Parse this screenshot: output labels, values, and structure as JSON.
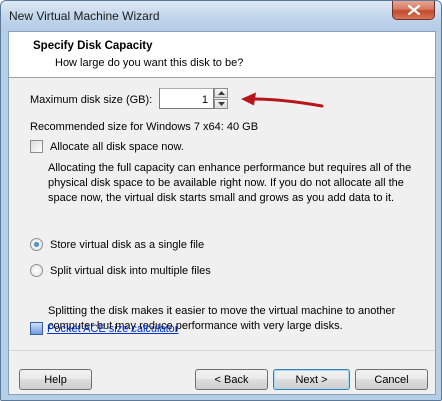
{
  "window": {
    "title": "New Virtual Machine Wizard"
  },
  "header": {
    "title": "Specify Disk Capacity",
    "subtitle": "How large do you want this disk to be?"
  },
  "disk_size": {
    "label": "Maximum disk size (GB):",
    "value": "1"
  },
  "recommended_text": "Recommended size for Windows 7 x64: 40 GB",
  "allocate": {
    "label": "Allocate all disk space now.",
    "checked": false,
    "description": "Allocating the full capacity can enhance performance but requires all of the physical disk space to be available right now. If you do not allocate all the space now, the virtual disk starts small and grows as you add data to it."
  },
  "storage_options": {
    "single_label": "Store virtual disk as a single file",
    "multiple_label": "Split virtual disk into multiple files",
    "selected": "single",
    "split_description": "Splitting the disk makes it easier to move the virtual machine to another computer but may reduce performance with very large disks."
  },
  "calculator_link": "Pocket ACE size calculator",
  "buttons": {
    "help": "Help",
    "back": "< Back",
    "next": "Next >",
    "cancel": "Cancel"
  },
  "colors": {
    "annotation_arrow": "#b8151b",
    "link": "#0033cc",
    "close_button": "#c24a2c"
  },
  "icons": {
    "close": "close-x-icon",
    "spinner_up": "triangle-up-icon",
    "spinner_down": "triangle-down-icon",
    "calculator": "calculator-icon"
  }
}
